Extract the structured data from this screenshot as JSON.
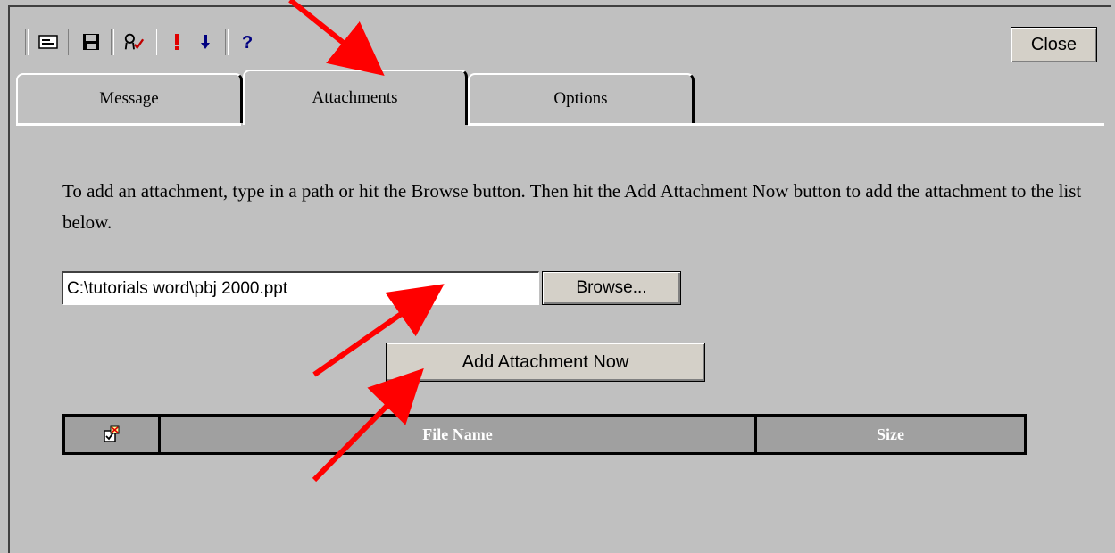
{
  "toolbar": {
    "icons": [
      "message-card-icon",
      "save-icon",
      "spell-check-icon",
      "high-priority-icon",
      "low-priority-icon",
      "help-icon"
    ],
    "close_label": "Close"
  },
  "tabs": [
    {
      "label": "Message"
    },
    {
      "label": "Attachments",
      "selected": true
    },
    {
      "label": "Options"
    }
  ],
  "main": {
    "instructions": "To add an attachment, type in a path or hit the Browse button. Then hit the Add Attachment Now button to add the attachment to the list below.",
    "path_value": "C:\\tutorials word\\pbj 2000.ppt",
    "browse_label": "Browse...",
    "add_label": "Add Attachment Now"
  },
  "table": {
    "columns": [
      "",
      "File Name",
      "Size"
    ]
  },
  "colors": {
    "background": "#c0c0c0",
    "annotation_arrow": "#ff0000",
    "table_header": "#a0a0a0"
  }
}
